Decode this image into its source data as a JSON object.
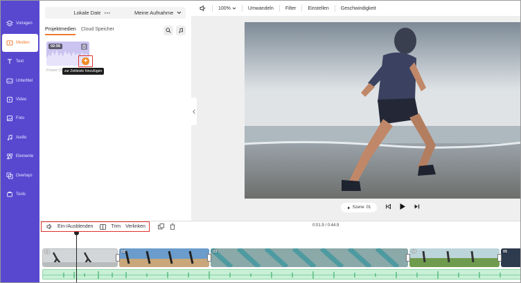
{
  "sidebar": {
    "items": [
      {
        "label": "Vorlagen",
        "icon": "layers-icon"
      },
      {
        "label": "Medien",
        "icon": "media-icon"
      },
      {
        "label": "Text",
        "icon": "text-icon"
      },
      {
        "label": "Untertitel",
        "icon": "subtitle-icon"
      },
      {
        "label": "Video",
        "icon": "video-icon"
      },
      {
        "label": "Foto",
        "icon": "photo-icon"
      },
      {
        "label": "Audio",
        "icon": "music-icon"
      },
      {
        "label": "Elemente",
        "icon": "elements-icon"
      },
      {
        "label": "Overlays",
        "icon": "overlays-icon"
      },
      {
        "label": "Tools",
        "icon": "tools-icon"
      }
    ],
    "active_index": 1
  },
  "media": {
    "local_files": "Lokale Dateien",
    "more": "···",
    "record": "Meine Aufnahme",
    "tab_project": "Projektmedien",
    "tab_cloud": "Cloud Speicher",
    "clip_duration": "02:56",
    "clip_name": "Power Ch",
    "add_tooltip": "zur Zeitleiste hinzufügen"
  },
  "toolbar": {
    "zoom": "100%",
    "convert": "Umwandeln",
    "filter": "Filter",
    "settings": "Einstellen",
    "speed": "Geschwindigkeit"
  },
  "player": {
    "scene_label": "Szene",
    "scene_number": "01"
  },
  "timeline": {
    "fade": "Ein-/Ausblenden",
    "trim": "Trim",
    "link": "Verlinken",
    "time": "0:01.9 / 0:44.9",
    "clips": [
      "01",
      "02",
      "03",
      "04",
      "05"
    ]
  },
  "colors": {
    "sidebar_bg": "#5848d0",
    "accent": "#f07b32",
    "highlight_border": "#e0302a"
  }
}
